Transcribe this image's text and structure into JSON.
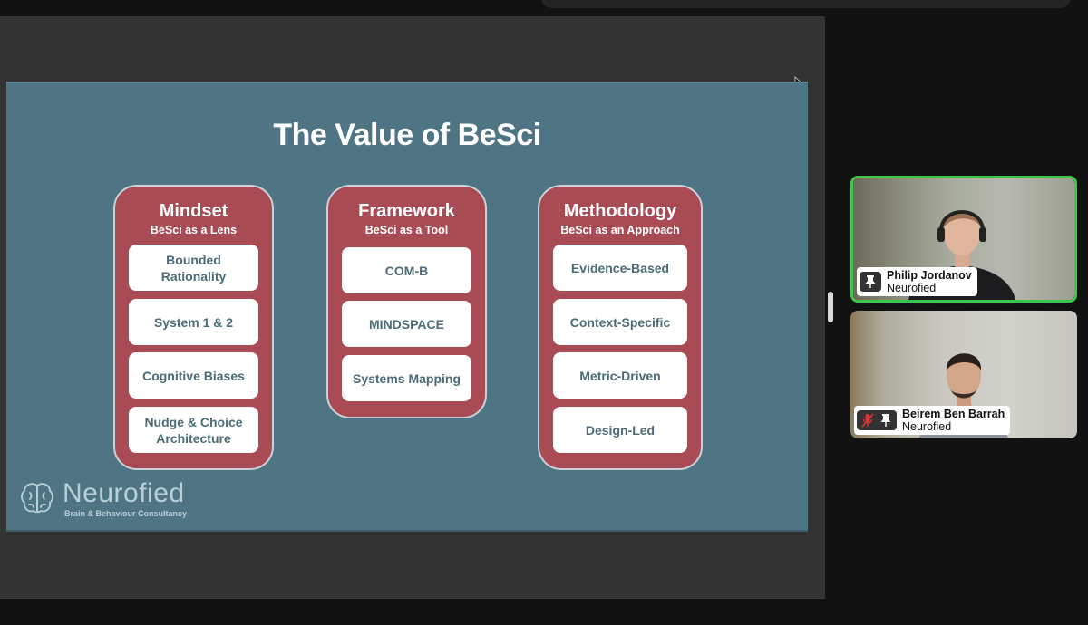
{
  "slide": {
    "title": "The Value of BeSci",
    "columns": [
      {
        "title": "Mindset",
        "subtitle": "BeSci as a Lens",
        "items": [
          "Bounded Rationality",
          "System 1 & 2",
          "Cognitive Biases",
          "Nudge & Choice Architecture"
        ]
      },
      {
        "title": "Framework",
        "subtitle": "BeSci as a Tool",
        "items": [
          "COM-B",
          "MINDSPACE",
          "Systems Mapping"
        ]
      },
      {
        "title": "Methodology",
        "subtitle": "BeSci as an Approach",
        "items": [
          "Evidence-Based",
          "Context-Specific",
          "Metric-Driven",
          "Design-Led"
        ]
      }
    ],
    "brand": {
      "name": "Neurofied",
      "tagline": "Brain & Behaviour Consultancy",
      "logo_icon": "brain-icon"
    }
  },
  "participants": [
    {
      "name": "Philip Jordanov",
      "org": "Neurofied",
      "active_speaker": true,
      "muted": false,
      "pinned_icon": "pin-icon"
    },
    {
      "name": "Beirem Ben Barrah",
      "org": "Neurofied",
      "active_speaker": false,
      "muted": true,
      "pinned_icon": "pin-icon"
    }
  ],
  "colors": {
    "slide_bg": "#4f7484",
    "column_bg": "#a94b54",
    "card_text": "#4c6b78",
    "speaker_border": "#3ec64a",
    "muted_icon": "#e0322f"
  }
}
